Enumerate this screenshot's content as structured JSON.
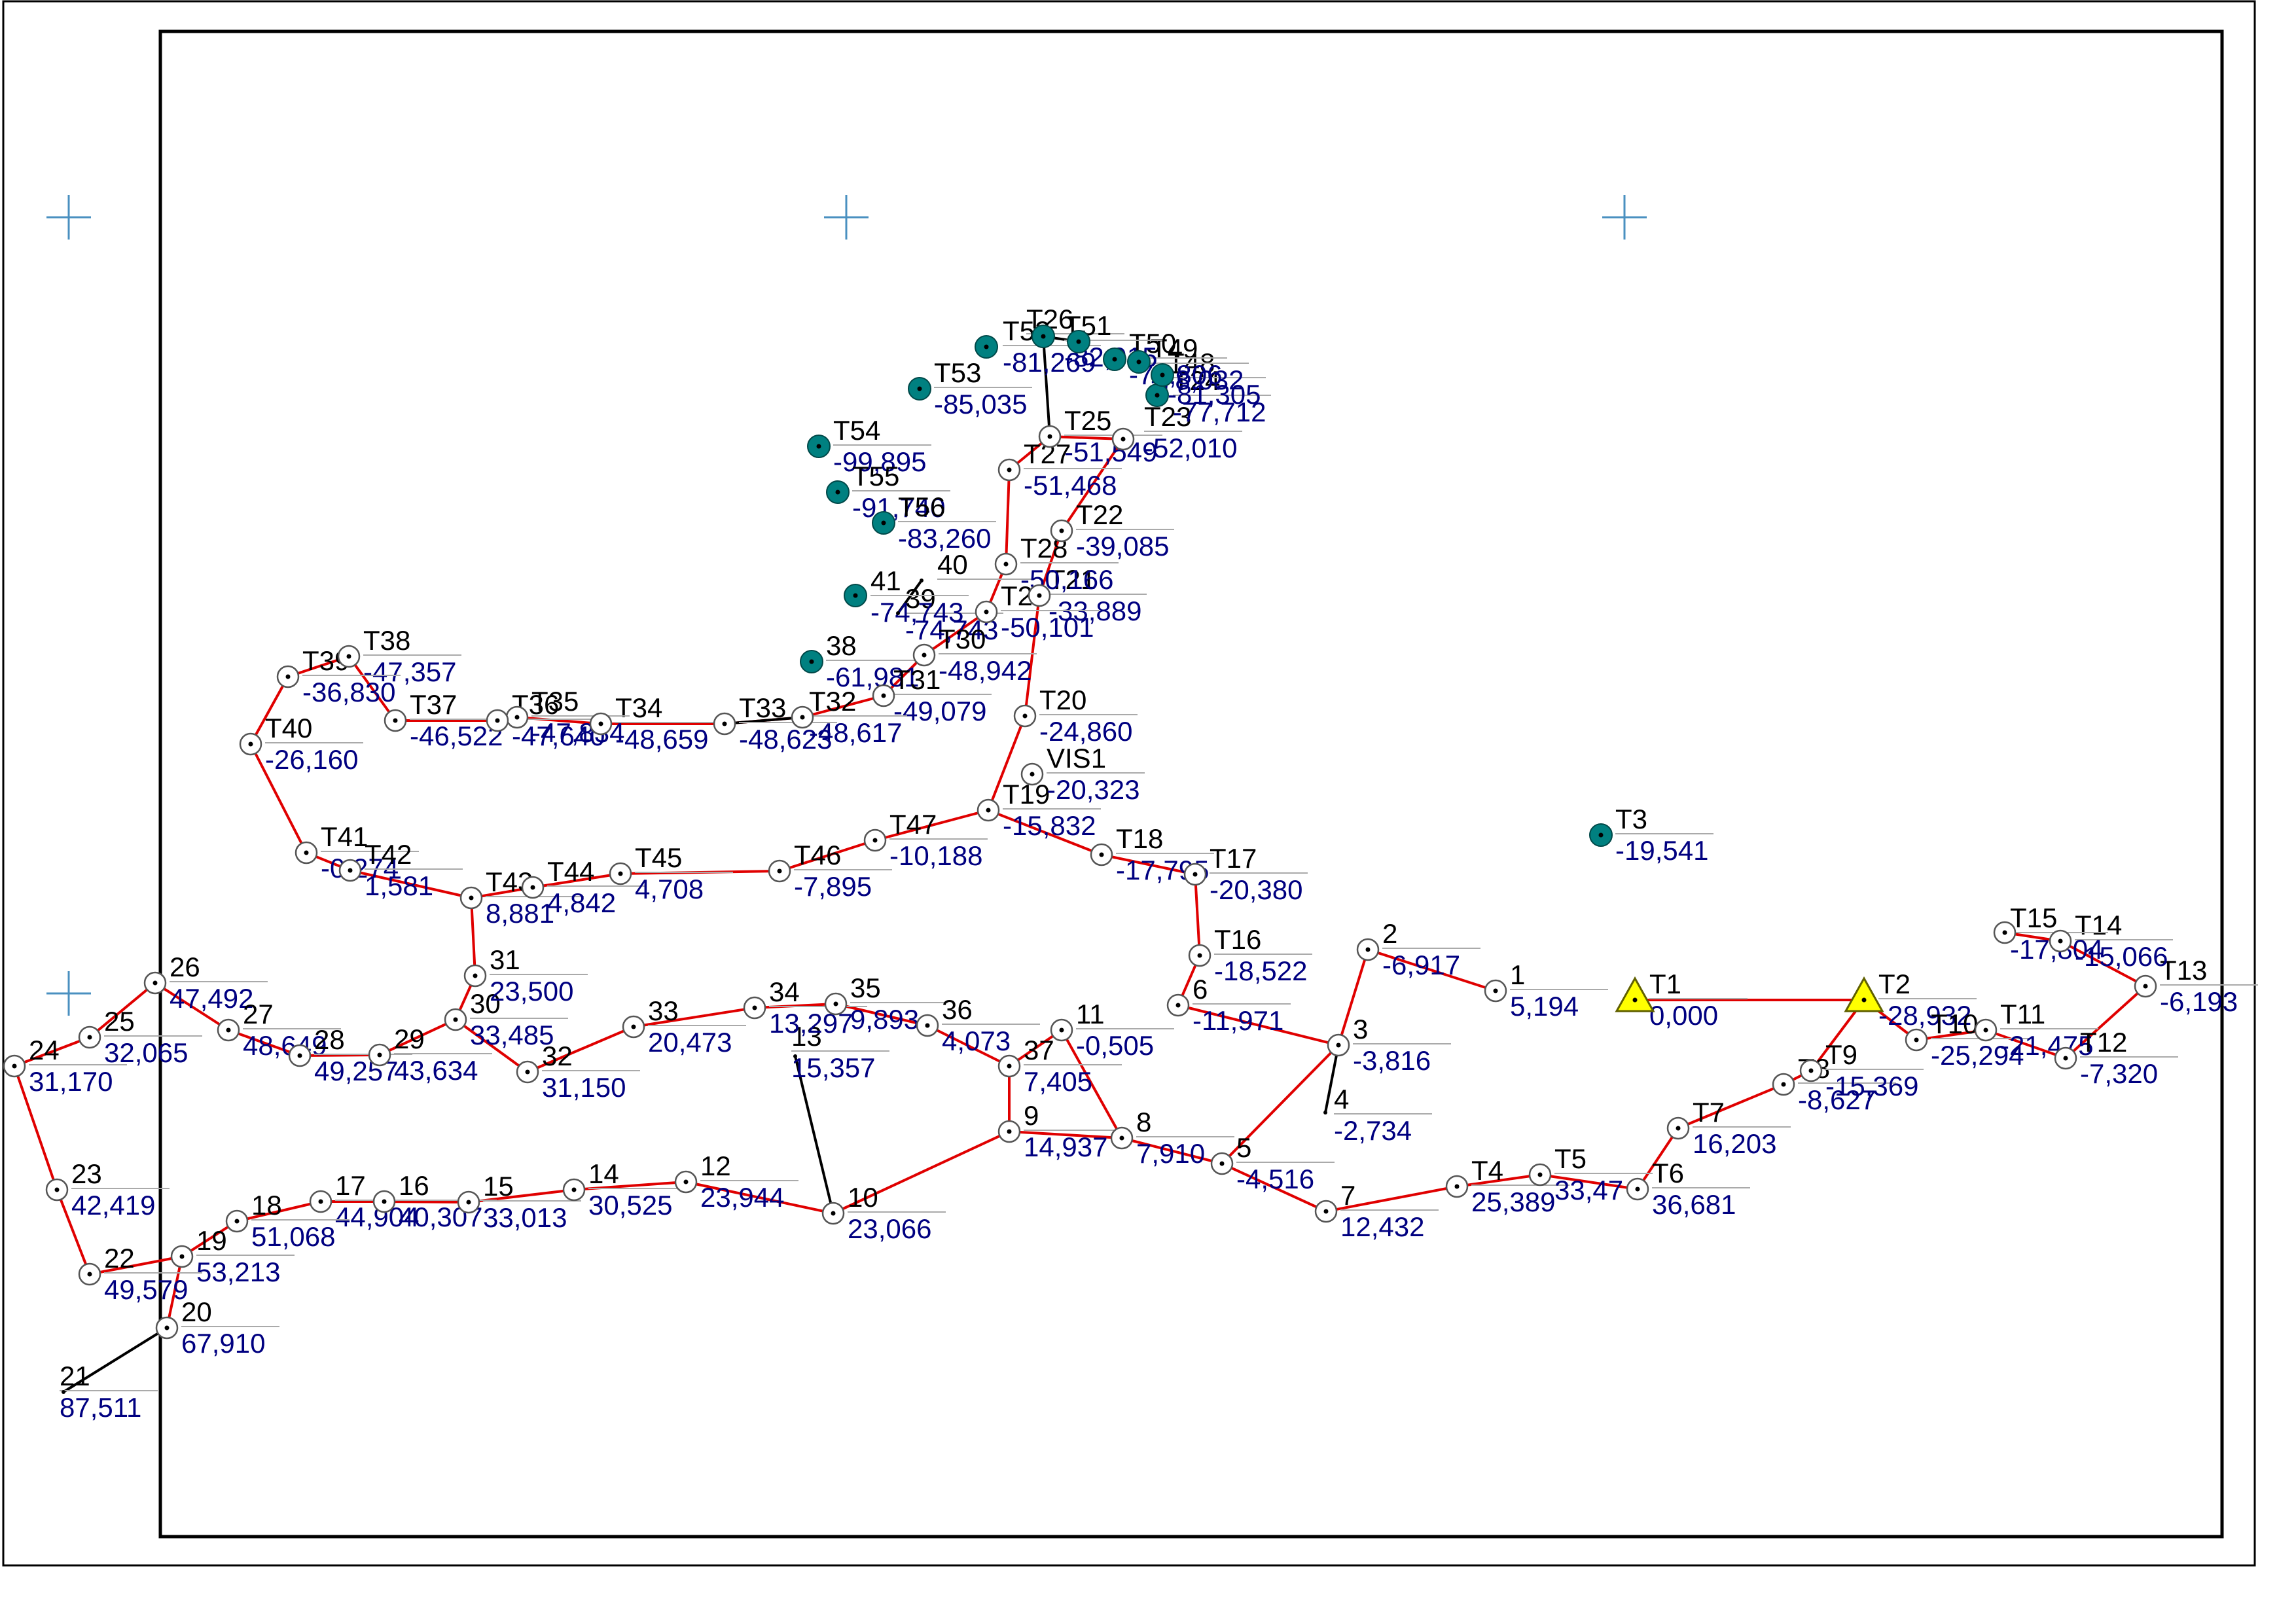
{
  "colors": {
    "traverse_line": "#e00000",
    "station_fill": "#ffffff",
    "control_fill": "#008080",
    "benchmark_fill": "#ffff00",
    "name_text": "#000000",
    "value_text": "#000080",
    "crosshair": "#4a90c0",
    "frame": "#000000"
  },
  "stations": [
    {
      "id": "T1",
      "name": "T1",
      "value": "0,000",
      "kind": "benchmark"
    },
    {
      "id": "T2",
      "name": "T2",
      "value": "-28,932",
      "kind": "benchmark"
    },
    {
      "id": "T3",
      "name": "T3",
      "value": "-19,541",
      "kind": "control"
    },
    {
      "id": "1",
      "name": "1",
      "value": "5,194",
      "kind": "station"
    },
    {
      "id": "2",
      "name": "2",
      "value": "-6,917",
      "kind": "station"
    },
    {
      "id": "3",
      "name": "3",
      "value": "-3,816",
      "kind": "station"
    },
    {
      "id": "4",
      "name": "4",
      "value": "-2,734",
      "kind": "point"
    },
    {
      "id": "5",
      "name": "5",
      "value": "-4,516",
      "kind": "station"
    },
    {
      "id": "6",
      "name": "6",
      "value": "-11,971",
      "kind": "station"
    },
    {
      "id": "7",
      "name": "7",
      "value": "12,432",
      "kind": "station"
    },
    {
      "id": "8",
      "name": "8",
      "value": "7,910",
      "kind": "station"
    },
    {
      "id": "9",
      "name": "9",
      "value": "14,937",
      "kind": "station"
    },
    {
      "id": "10",
      "name": "10",
      "value": "23,066",
      "kind": "station"
    },
    {
      "id": "11",
      "name": "11",
      "value": "-0,505",
      "kind": "station"
    },
    {
      "id": "12",
      "name": "12",
      "value": "23,944",
      "kind": "station"
    },
    {
      "id": "13",
      "name": "13",
      "value": "15,357",
      "kind": "point"
    },
    {
      "id": "14",
      "name": "14",
      "value": "30,525",
      "kind": "station"
    },
    {
      "id": "15",
      "name": "15",
      "value": "33,013",
      "kind": "station"
    },
    {
      "id": "16",
      "name": "16",
      "value": "40,307",
      "kind": "station"
    },
    {
      "id": "17",
      "name": "17",
      "value": "44,904",
      "kind": "station"
    },
    {
      "id": "18",
      "name": "18",
      "value": "51,068",
      "kind": "station"
    },
    {
      "id": "19",
      "name": "19",
      "value": "53,213",
      "kind": "station"
    },
    {
      "id": "20",
      "name": "20",
      "value": "67,910",
      "kind": "station"
    },
    {
      "id": "21",
      "name": "21",
      "value": "87,511",
      "kind": "point"
    },
    {
      "id": "22",
      "name": "22",
      "value": "49,579",
      "kind": "station"
    },
    {
      "id": "23",
      "name": "23",
      "value": "42,419",
      "kind": "station"
    },
    {
      "id": "24",
      "name": "24",
      "value": "31,170",
      "kind": "station"
    },
    {
      "id": "25",
      "name": "25",
      "value": "32,065",
      "kind": "station"
    },
    {
      "id": "26",
      "name": "26",
      "value": "47,492",
      "kind": "station"
    },
    {
      "id": "27",
      "name": "27",
      "value": "48,649",
      "kind": "station"
    },
    {
      "id": "28",
      "name": "28",
      "value": "49,257",
      "kind": "station"
    },
    {
      "id": "29",
      "name": "29",
      "value": "43,634",
      "kind": "station"
    },
    {
      "id": "30",
      "name": "30",
      "value": "33,485",
      "kind": "station"
    },
    {
      "id": "31",
      "name": "31",
      "value": "23,500",
      "kind": "station"
    },
    {
      "id": "32",
      "name": "32",
      "value": "31,150",
      "kind": "station"
    },
    {
      "id": "33",
      "name": "33",
      "value": "20,473",
      "kind": "station"
    },
    {
      "id": "34",
      "name": "34",
      "value": "13,297",
      "kind": "station"
    },
    {
      "id": "35",
      "name": "35",
      "value": "9,893",
      "kind": "station"
    },
    {
      "id": "36",
      "name": "36",
      "value": "4,073",
      "kind": "station"
    },
    {
      "id": "37",
      "name": "37",
      "value": "7,405",
      "kind": "station"
    },
    {
      "id": "38",
      "name": "38",
      "value": "-61,981",
      "kind": "control"
    },
    {
      "id": "39",
      "name": "39",
      "value": "-74,743",
      "kind": "point"
    },
    {
      "id": "40",
      "name": "40",
      "value": "",
      "kind": "point"
    },
    {
      "id": "41",
      "name": "41",
      "value": "-74,743",
      "kind": "control"
    },
    {
      "id": "T4",
      "name": "T4",
      "value": "25,389",
      "kind": "station"
    },
    {
      "id": "T5",
      "name": "T5",
      "value": "33,47",
      "kind": "station"
    },
    {
      "id": "T6",
      "name": "T6",
      "value": "36,681",
      "kind": "station"
    },
    {
      "id": "T7",
      "name": "T7",
      "value": "16,203",
      "kind": "station"
    },
    {
      "id": "T8",
      "name": "T8",
      "value": "-8,627",
      "kind": "station"
    },
    {
      "id": "T9",
      "name": "T9",
      "value": "-15,369",
      "kind": "station"
    },
    {
      "id": "T10",
      "name": "T10",
      "value": "-25,294",
      "kind": "station"
    },
    {
      "id": "T11",
      "name": "T11",
      "value": "-21,475",
      "kind": "station"
    },
    {
      "id": "T12",
      "name": "T12",
      "value": "-7,320",
      "kind": "station"
    },
    {
      "id": "T13",
      "name": "T13",
      "value": "-6,193",
      "kind": "station"
    },
    {
      "id": "T14",
      "name": "T14",
      "value": "-15,066",
      "kind": "station"
    },
    {
      "id": "T15",
      "name": "T15",
      "value": "-17,804",
      "kind": "station"
    },
    {
      "id": "T16",
      "name": "T16",
      "value": "-18,522",
      "kind": "station"
    },
    {
      "id": "T17",
      "name": "T17",
      "value": "-20,380",
      "kind": "station"
    },
    {
      "id": "T18",
      "name": "T18",
      "value": "-17,795",
      "kind": "station"
    },
    {
      "id": "T19",
      "name": "T19",
      "value": "-15,832",
      "kind": "station"
    },
    {
      "id": "VIS1",
      "name": "VIS1",
      "value": "-20,323",
      "kind": "station"
    },
    {
      "id": "T20",
      "name": "T20",
      "value": "-24,860",
      "kind": "station"
    },
    {
      "id": "T21",
      "name": "T21",
      "value": "-33,889",
      "kind": "station"
    },
    {
      "id": "T22",
      "name": "T22",
      "value": "-39,085",
      "kind": "station"
    },
    {
      "id": "T23",
      "name": "T23",
      "value": "-52,010",
      "kind": "station"
    },
    {
      "id": "T24",
      "name": "T24",
      "value": "-77,712",
      "kind": "control"
    },
    {
      "id": "T25",
      "name": "T25",
      "value": "-51,549",
      "kind": "station"
    },
    {
      "id": "T26",
      "name": "T26",
      "value": "",
      "kind": "control"
    },
    {
      "id": "T27",
      "name": "T27",
      "value": "-51,468",
      "kind": "station"
    },
    {
      "id": "T28",
      "name": "T28",
      "value": "-50,166",
      "kind": "station"
    },
    {
      "id": "T29",
      "name": "T29",
      "value": "-50,101",
      "kind": "station"
    },
    {
      "id": "T30",
      "name": "T30",
      "value": "-48,942",
      "kind": "station"
    },
    {
      "id": "T31",
      "name": "T31",
      "value": "-49,079",
      "kind": "station"
    },
    {
      "id": "T32",
      "name": "T32",
      "value": "-48,617",
      "kind": "station"
    },
    {
      "id": "T33",
      "name": "T33",
      "value": "-48,623",
      "kind": "station"
    },
    {
      "id": "T34",
      "name": "T34",
      "value": "-48,659",
      "kind": "station"
    },
    {
      "id": "T35",
      "name": "T35",
      "value": "-47,834",
      "kind": "station"
    },
    {
      "id": "T36",
      "name": "T36",
      "value": "-47,640",
      "kind": "station"
    },
    {
      "id": "T37",
      "name": "T37",
      "value": "-46,522",
      "kind": "station"
    },
    {
      "id": "T38",
      "name": "T38",
      "value": "-47,357",
      "kind": "station"
    },
    {
      "id": "T39",
      "name": "T39",
      "value": "-36,830",
      "kind": "station"
    },
    {
      "id": "T40",
      "name": "T40",
      "value": "-26,160",
      "kind": "station"
    },
    {
      "id": "T41",
      "name": "T41",
      "value": "-0,274",
      "kind": "station"
    },
    {
      "id": "T42",
      "name": "T42",
      "value": "1,581",
      "kind": "station"
    },
    {
      "id": "T43",
      "name": "T43",
      "value": "8,881",
      "kind": "station"
    },
    {
      "id": "T44",
      "name": "T44",
      "value": "4,842",
      "kind": "station"
    },
    {
      "id": "T45",
      "name": "T45",
      "value": "4,708",
      "kind": "station"
    },
    {
      "id": "T46",
      "name": "T46",
      "value": "-7,895",
      "kind": "station"
    },
    {
      "id": "T47",
      "name": "T47",
      "value": "-10,188",
      "kind": "station"
    },
    {
      "id": "T48",
      "name": "T48",
      "value": "-81,305",
      "kind": "control"
    },
    {
      "id": "T49",
      "name": "T49",
      "value": "-78,032",
      "kind": "control"
    },
    {
      "id": "T50",
      "name": "T50",
      "value": "-72,806",
      "kind": "control"
    },
    {
      "id": "T51",
      "name": "T51",
      "value": "-82,915",
      "kind": "control"
    },
    {
      "id": "T52",
      "name": "T52",
      "value": "-81,269",
      "kind": "control"
    },
    {
      "id": "T53",
      "name": "T53",
      "value": "-85,035",
      "kind": "control"
    },
    {
      "id": "T54",
      "name": "T54",
      "value": "-99,895",
      "kind": "control"
    },
    {
      "id": "T55",
      "name": "T55",
      "value": "-91,740",
      "kind": "control"
    },
    {
      "id": "T56",
      "name": "T56",
      "value": "-83,260",
      "kind": "control"
    }
  ]
}
